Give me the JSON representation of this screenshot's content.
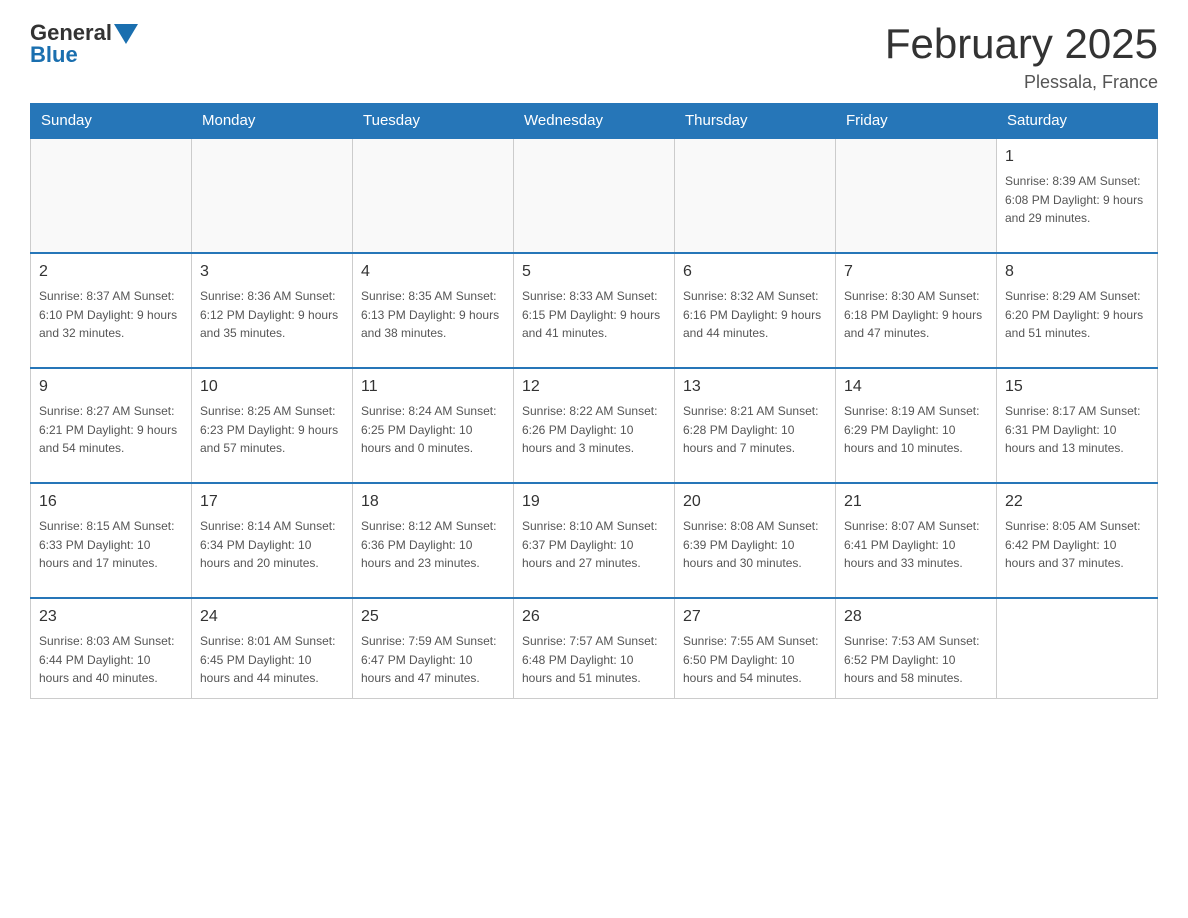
{
  "header": {
    "logo_general": "General",
    "logo_blue": "Blue",
    "title": "February 2025",
    "location": "Plessala, France"
  },
  "calendar": {
    "days_of_week": [
      "Sunday",
      "Monday",
      "Tuesday",
      "Wednesday",
      "Thursday",
      "Friday",
      "Saturday"
    ],
    "weeks": [
      {
        "days": [
          {
            "date": "",
            "info": ""
          },
          {
            "date": "",
            "info": ""
          },
          {
            "date": "",
            "info": ""
          },
          {
            "date": "",
            "info": ""
          },
          {
            "date": "",
            "info": ""
          },
          {
            "date": "",
            "info": ""
          },
          {
            "date": "1",
            "info": "Sunrise: 8:39 AM\nSunset: 6:08 PM\nDaylight: 9 hours and 29 minutes."
          }
        ]
      },
      {
        "days": [
          {
            "date": "2",
            "info": "Sunrise: 8:37 AM\nSunset: 6:10 PM\nDaylight: 9 hours and 32 minutes."
          },
          {
            "date": "3",
            "info": "Sunrise: 8:36 AM\nSunset: 6:12 PM\nDaylight: 9 hours and 35 minutes."
          },
          {
            "date": "4",
            "info": "Sunrise: 8:35 AM\nSunset: 6:13 PM\nDaylight: 9 hours and 38 minutes."
          },
          {
            "date": "5",
            "info": "Sunrise: 8:33 AM\nSunset: 6:15 PM\nDaylight: 9 hours and 41 minutes."
          },
          {
            "date": "6",
            "info": "Sunrise: 8:32 AM\nSunset: 6:16 PM\nDaylight: 9 hours and 44 minutes."
          },
          {
            "date": "7",
            "info": "Sunrise: 8:30 AM\nSunset: 6:18 PM\nDaylight: 9 hours and 47 minutes."
          },
          {
            "date": "8",
            "info": "Sunrise: 8:29 AM\nSunset: 6:20 PM\nDaylight: 9 hours and 51 minutes."
          }
        ]
      },
      {
        "days": [
          {
            "date": "9",
            "info": "Sunrise: 8:27 AM\nSunset: 6:21 PM\nDaylight: 9 hours and 54 minutes."
          },
          {
            "date": "10",
            "info": "Sunrise: 8:25 AM\nSunset: 6:23 PM\nDaylight: 9 hours and 57 minutes."
          },
          {
            "date": "11",
            "info": "Sunrise: 8:24 AM\nSunset: 6:25 PM\nDaylight: 10 hours and 0 minutes."
          },
          {
            "date": "12",
            "info": "Sunrise: 8:22 AM\nSunset: 6:26 PM\nDaylight: 10 hours and 3 minutes."
          },
          {
            "date": "13",
            "info": "Sunrise: 8:21 AM\nSunset: 6:28 PM\nDaylight: 10 hours and 7 minutes."
          },
          {
            "date": "14",
            "info": "Sunrise: 8:19 AM\nSunset: 6:29 PM\nDaylight: 10 hours and 10 minutes."
          },
          {
            "date": "15",
            "info": "Sunrise: 8:17 AM\nSunset: 6:31 PM\nDaylight: 10 hours and 13 minutes."
          }
        ]
      },
      {
        "days": [
          {
            "date": "16",
            "info": "Sunrise: 8:15 AM\nSunset: 6:33 PM\nDaylight: 10 hours and 17 minutes."
          },
          {
            "date": "17",
            "info": "Sunrise: 8:14 AM\nSunset: 6:34 PM\nDaylight: 10 hours and 20 minutes."
          },
          {
            "date": "18",
            "info": "Sunrise: 8:12 AM\nSunset: 6:36 PM\nDaylight: 10 hours and 23 minutes."
          },
          {
            "date": "19",
            "info": "Sunrise: 8:10 AM\nSunset: 6:37 PM\nDaylight: 10 hours and 27 minutes."
          },
          {
            "date": "20",
            "info": "Sunrise: 8:08 AM\nSunset: 6:39 PM\nDaylight: 10 hours and 30 minutes."
          },
          {
            "date": "21",
            "info": "Sunrise: 8:07 AM\nSunset: 6:41 PM\nDaylight: 10 hours and 33 minutes."
          },
          {
            "date": "22",
            "info": "Sunrise: 8:05 AM\nSunset: 6:42 PM\nDaylight: 10 hours and 37 minutes."
          }
        ]
      },
      {
        "days": [
          {
            "date": "23",
            "info": "Sunrise: 8:03 AM\nSunset: 6:44 PM\nDaylight: 10 hours and 40 minutes."
          },
          {
            "date": "24",
            "info": "Sunrise: 8:01 AM\nSunset: 6:45 PM\nDaylight: 10 hours and 44 minutes."
          },
          {
            "date": "25",
            "info": "Sunrise: 7:59 AM\nSunset: 6:47 PM\nDaylight: 10 hours and 47 minutes."
          },
          {
            "date": "26",
            "info": "Sunrise: 7:57 AM\nSunset: 6:48 PM\nDaylight: 10 hours and 51 minutes."
          },
          {
            "date": "27",
            "info": "Sunrise: 7:55 AM\nSunset: 6:50 PM\nDaylight: 10 hours and 54 minutes."
          },
          {
            "date": "28",
            "info": "Sunrise: 7:53 AM\nSunset: 6:52 PM\nDaylight: 10 hours and 58 minutes."
          },
          {
            "date": "",
            "info": ""
          }
        ]
      }
    ]
  }
}
